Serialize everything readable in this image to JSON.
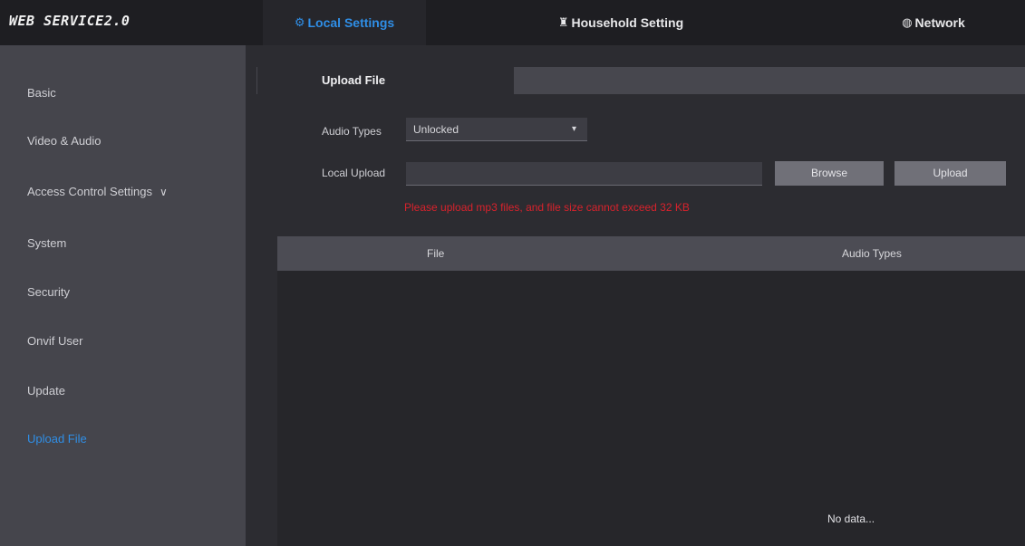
{
  "app": {
    "brand": "WEB SERVICE2.0"
  },
  "topnav": {
    "local": {
      "icon": "settings-icon",
      "label": "Local Settings"
    },
    "household": {
      "icon": "household-icon",
      "label": "Household Setting"
    },
    "network": {
      "icon": "globe-icon",
      "label": "Network"
    }
  },
  "sidebar": {
    "items": [
      {
        "label": "Basic"
      },
      {
        "label": "Video & Audio"
      },
      {
        "label": "Access Control Settings"
      },
      {
        "label": "System"
      },
      {
        "label": "Security"
      },
      {
        "label": "Onvif User"
      },
      {
        "label": "Update"
      },
      {
        "label": "Upload File"
      }
    ]
  },
  "tab": {
    "label": "Upload File"
  },
  "form": {
    "audio_type_label": "Audio Types",
    "audio_type_value": "Unlocked",
    "local_upload_label": "Local Upload",
    "browse_label": "Browse",
    "upload_label": "Upload",
    "warning": "Please upload mp3 files, and file size cannot exceed 32 KB"
  },
  "table": {
    "columns": [
      "File",
      "Audio Types"
    ],
    "empty_text": "No data..."
  },
  "colors": {
    "accent": "#2f8ee6",
    "warning": "#d8222c"
  }
}
